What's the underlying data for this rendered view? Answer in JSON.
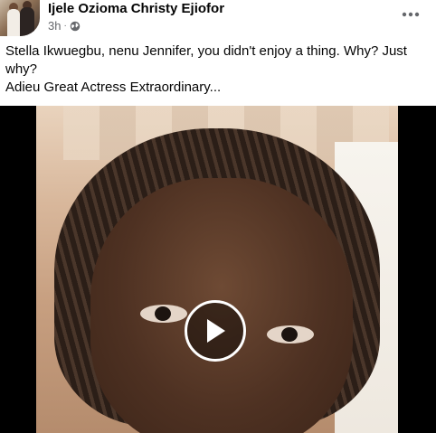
{
  "post": {
    "author": "Ijele Ozioma Christy Ejiofor",
    "time": "3h",
    "separator": "·",
    "audience_icon": "globe-icon",
    "more_icon": "more-horizontal-icon",
    "caption_line1": "Stella Ikwuegbu, nenu Jennifer, you didn't enjoy a thing. Why? Just why?",
    "caption_line2": "Adieu Great Actress Extraordinary..."
  },
  "video": {
    "play_icon": "play-icon"
  }
}
